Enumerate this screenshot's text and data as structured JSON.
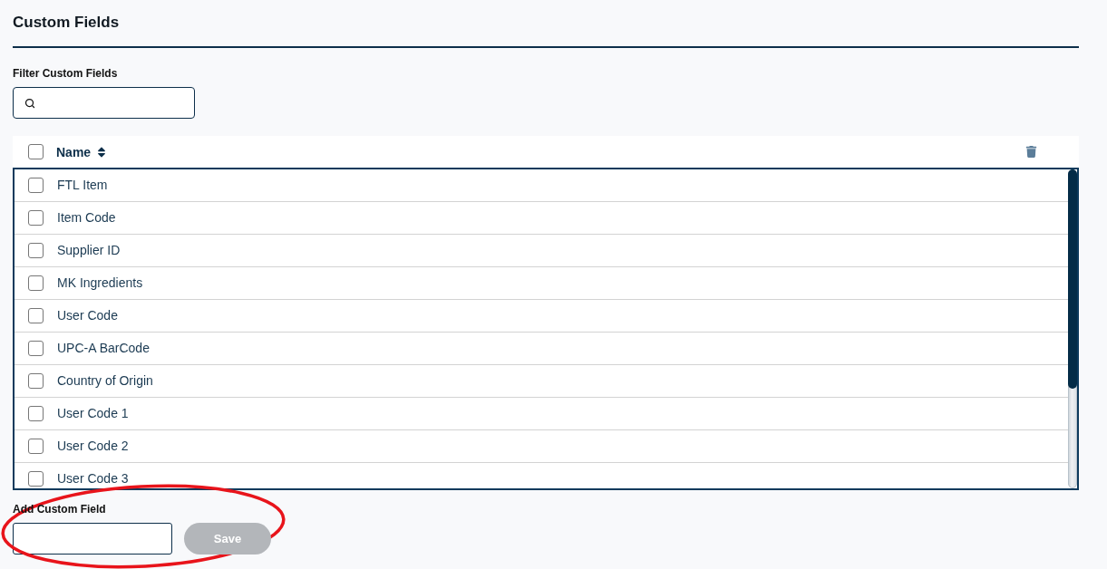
{
  "title": "Custom Fields",
  "filter": {
    "label": "Filter Custom Fields"
  },
  "table": {
    "select_all_checked": false,
    "columns": [
      {
        "label": "Name"
      }
    ],
    "rows": [
      {
        "name": "FTL Item",
        "checked": false
      },
      {
        "name": "Item Code",
        "checked": false
      },
      {
        "name": "Supplier ID",
        "checked": false
      },
      {
        "name": "MK Ingredients",
        "checked": false
      },
      {
        "name": "User Code",
        "checked": false
      },
      {
        "name": "UPC-A BarCode",
        "checked": false
      },
      {
        "name": "Country of Origin",
        "checked": false
      },
      {
        "name": "User Code 1",
        "checked": false
      },
      {
        "name": "User Code 2",
        "checked": false
      },
      {
        "name": "User Code 3",
        "checked": false
      }
    ]
  },
  "add_field": {
    "label": "Add Custom Field",
    "button": {
      "label": "Save",
      "disabled": true
    }
  }
}
